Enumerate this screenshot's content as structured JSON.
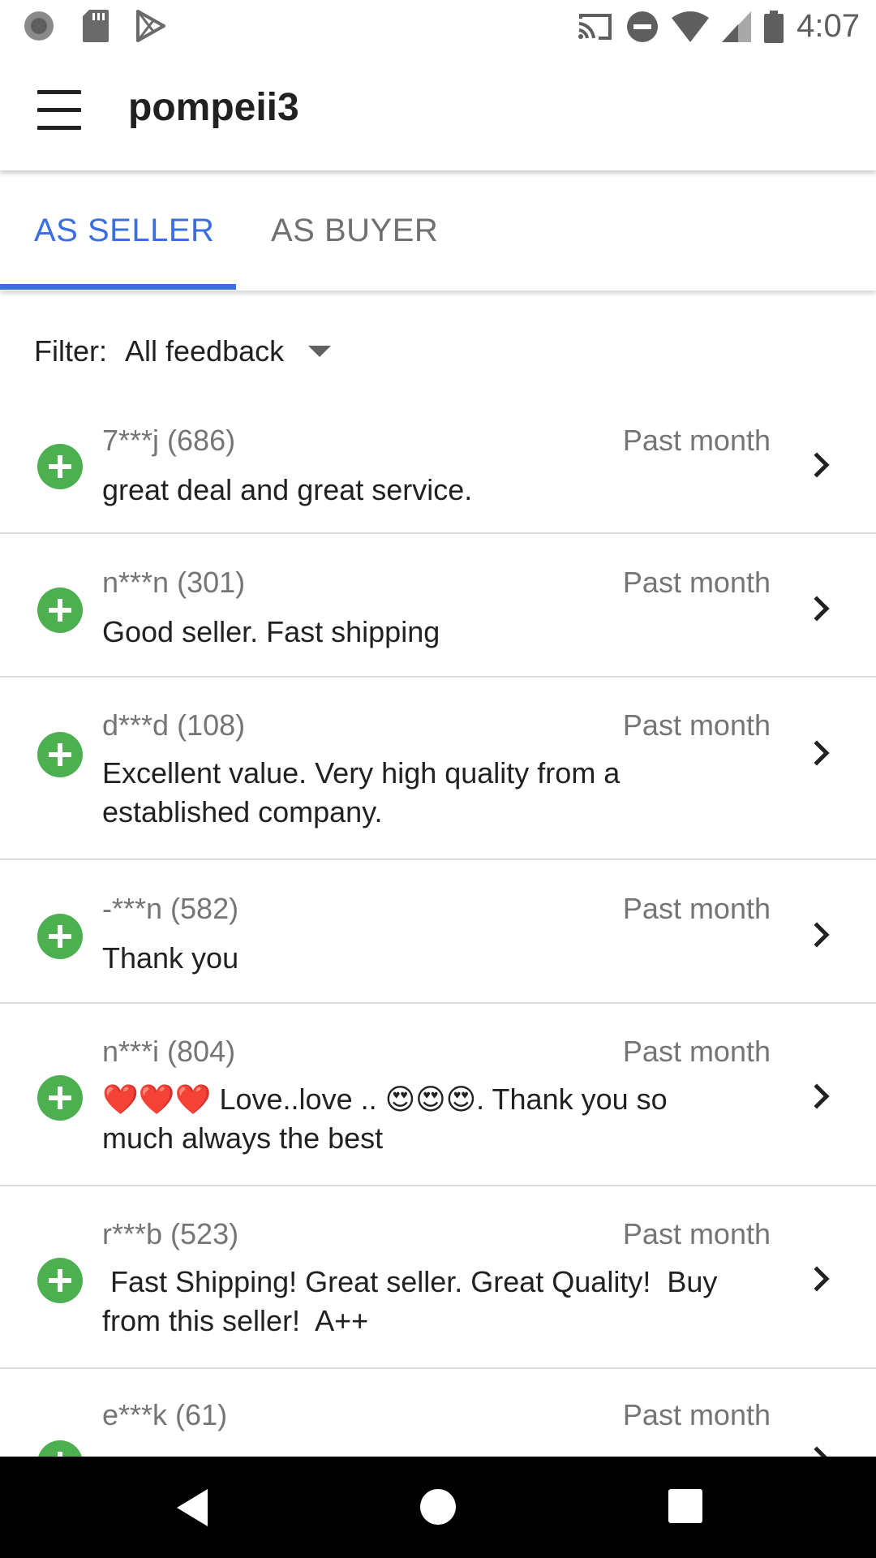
{
  "status_bar": {
    "time": "4:07",
    "left_icons": [
      "record-icon",
      "sd-card-icon",
      "play-store-icon"
    ],
    "right_icons": [
      "cast-icon",
      "do-not-disturb-icon",
      "wifi-icon",
      "signal-icon",
      "battery-icon"
    ]
  },
  "app_bar": {
    "title": "pompeii3",
    "menu_icon": "hamburger-menu-icon"
  },
  "tabs": [
    {
      "label": "AS SELLER",
      "active": true
    },
    {
      "label": "AS BUYER",
      "active": false
    }
  ],
  "filter": {
    "label": "Filter:",
    "value": "All feedback"
  },
  "feedback": [
    {
      "user": "7***j (686)",
      "time": "Past month",
      "comment": "great deal and great service.",
      "type": "positive"
    },
    {
      "user": "n***n (301)",
      "time": "Past month",
      "comment": "Good seller. Fast shipping",
      "type": "positive"
    },
    {
      "user": "d***d (108)",
      "time": "Past month",
      "comment": "Excellent value. Very high quality from a established company.",
      "type": "positive"
    },
    {
      "user": "-***n (582)",
      "time": "Past month",
      "comment": "Thank you",
      "type": "positive"
    },
    {
      "user": "n***i (804)",
      "time": "Past month",
      "comment": "❤️❤️❤️ Love..love .. 😍😍😍. Thank you so much always the best",
      "type": "positive"
    },
    {
      "user": "r***b (523)",
      "time": "Past month",
      "comment": " Fast Shipping! Great seller. Great Quality!  Buy from this seller!  A++",
      "type": "positive"
    },
    {
      "user": "e***k (61)",
      "time": "Past month",
      "comment": "",
      "type": "positive"
    }
  ],
  "colors": {
    "accent": "#3b6fe0",
    "positive": "#4caf50",
    "secondary_text": "#757575"
  }
}
